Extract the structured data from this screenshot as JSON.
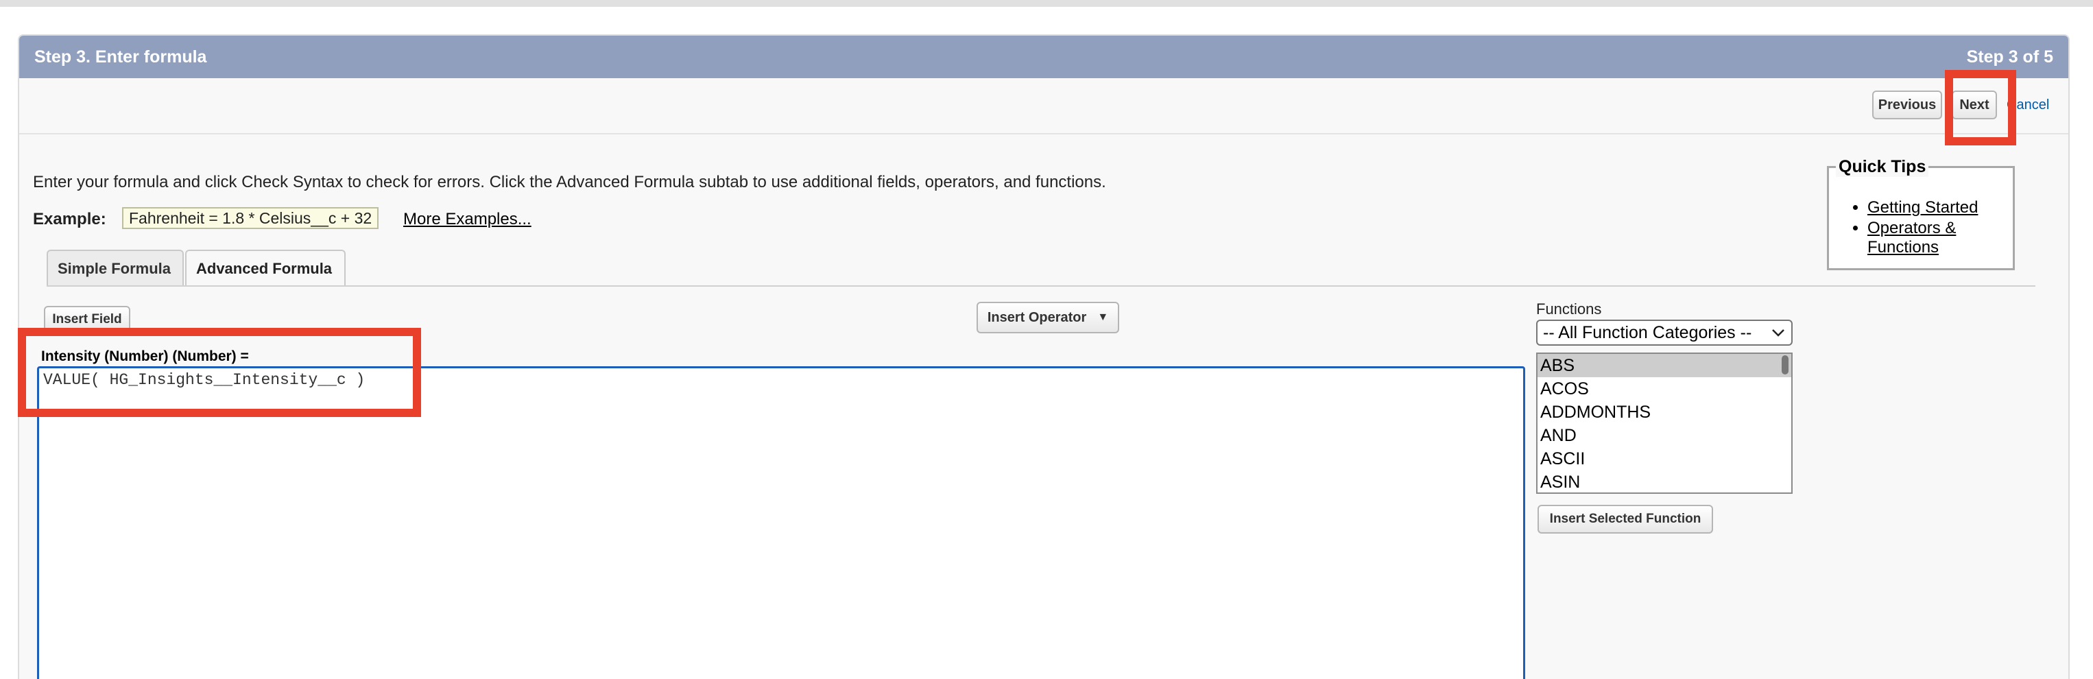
{
  "header": {
    "title": "Step 3. Enter formula",
    "step": "Step 3 of 5"
  },
  "nav": {
    "previous": "Previous",
    "next": "Next",
    "cancel": "Cancel"
  },
  "instructions": "Enter your formula and click Check Syntax to check for errors. Click the Advanced Formula subtab to use additional fields, operators, and functions.",
  "example": {
    "label": "Example:",
    "formula": "Fahrenheit = 1.8 * Celsius__c + 32",
    "more_link": "More Examples..."
  },
  "quick_tips": {
    "title": "Quick Tips",
    "links": [
      "Getting Started",
      "Operators & Functions"
    ]
  },
  "tabs": [
    {
      "label": "Simple Formula",
      "active": false
    },
    {
      "label": "Advanced Formula",
      "active": true
    }
  ],
  "toolbar": {
    "insert_field": "Insert Field",
    "insert_operator": "Insert Operator",
    "insert_operator_arrow": "▼"
  },
  "formula": {
    "label": "Intensity (Number) (Number) =",
    "value": "VALUE( HG_Insights__Intensity__c )"
  },
  "functions": {
    "label": "Functions",
    "category_selected": "-- All Function Categories --",
    "dropdown_icon": "chevron-down-icon",
    "items": [
      "ABS",
      "ACOS",
      "ADDMONTHS",
      "AND",
      "ASCII",
      "ASIN"
    ],
    "selected_item": "ABS",
    "insert_button": "Insert Selected Function"
  },
  "colors": {
    "header_bg": "#8f9fbd",
    "highlight_red": "#e8402b",
    "editor_border": "#1b5fb9",
    "link_blue": "#015ba7"
  }
}
